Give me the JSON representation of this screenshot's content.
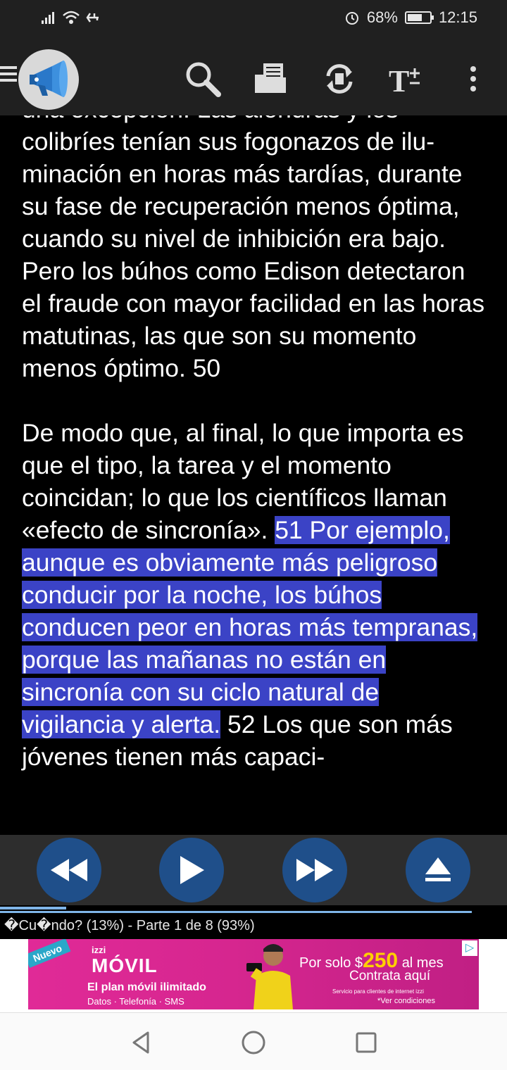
{
  "status_bar": {
    "battery_percent": "68%",
    "battery_level": 0.68,
    "time": "12:15",
    "icons": [
      "signal-icon",
      "wifi-icon",
      "usb-icon",
      "alarm-icon",
      "battery-icon"
    ]
  },
  "toolbar": {
    "icons": [
      "menu-icon",
      "megaphone-logo-icon",
      "search-icon",
      "open-folder-icon",
      "sync-icon",
      "text-size-icon",
      "more-vert-icon"
    ]
  },
  "reader": {
    "paragraph1": "una excepción. Las alondras y los colibríes tenían sus fogonazos de ilu­minación en horas más tardías, du­rante su fase de recuperación menos óptima, cuando su nivel de inhibición era bajo. Pero los búhos como Edi­son detectaron el fraude con mayor facilidad en las horas matutinas, las que son su momento menos óptimo. 50",
    "paragraph2_before": "De modo que, al final, lo que importa es que el tipo, la tarea y el momento coincidan; lo que los científicos lla­man «efecto de sincronía». ",
    "paragraph2_highlight": "51 Por ejemplo, aunque es obviamente más peligroso conducir por la noche, los búhos conducen peor en horas más tempranas, porque las mañanas no están en sincronía con su ciclo natu­ral de vigilancia y alerta.",
    "paragraph2_after": " 52 Los que son más jóvenes tienen más capaci-",
    "highlight_color": "#3b43c6"
  },
  "controls": {
    "buttons": [
      "rewind-icon",
      "play-icon",
      "fast-forward-icon",
      "eject-icon"
    ],
    "button_color": "#1f4f8a"
  },
  "progress": {
    "fraction": 0.13,
    "status_text": "�Cu�ndo? (13%) - Parte 1 de 8 (93%)"
  },
  "ad": {
    "badge": "Nuevo",
    "brand": "izzi",
    "product": "MÓVIL",
    "plan": "El plan móvil ilimitado",
    "features": "Datos · Telefonía · SMS",
    "price_prefix": "Por solo $",
    "price": "250",
    "price_suffix": "al mes",
    "cta": "Contrata aquí",
    "fineprint": "Servicio para clientes de internet izzi",
    "conditions": "*Ver condiciones"
  },
  "navbar": {
    "buttons": [
      "back-icon",
      "home-icon",
      "recents-icon"
    ]
  }
}
